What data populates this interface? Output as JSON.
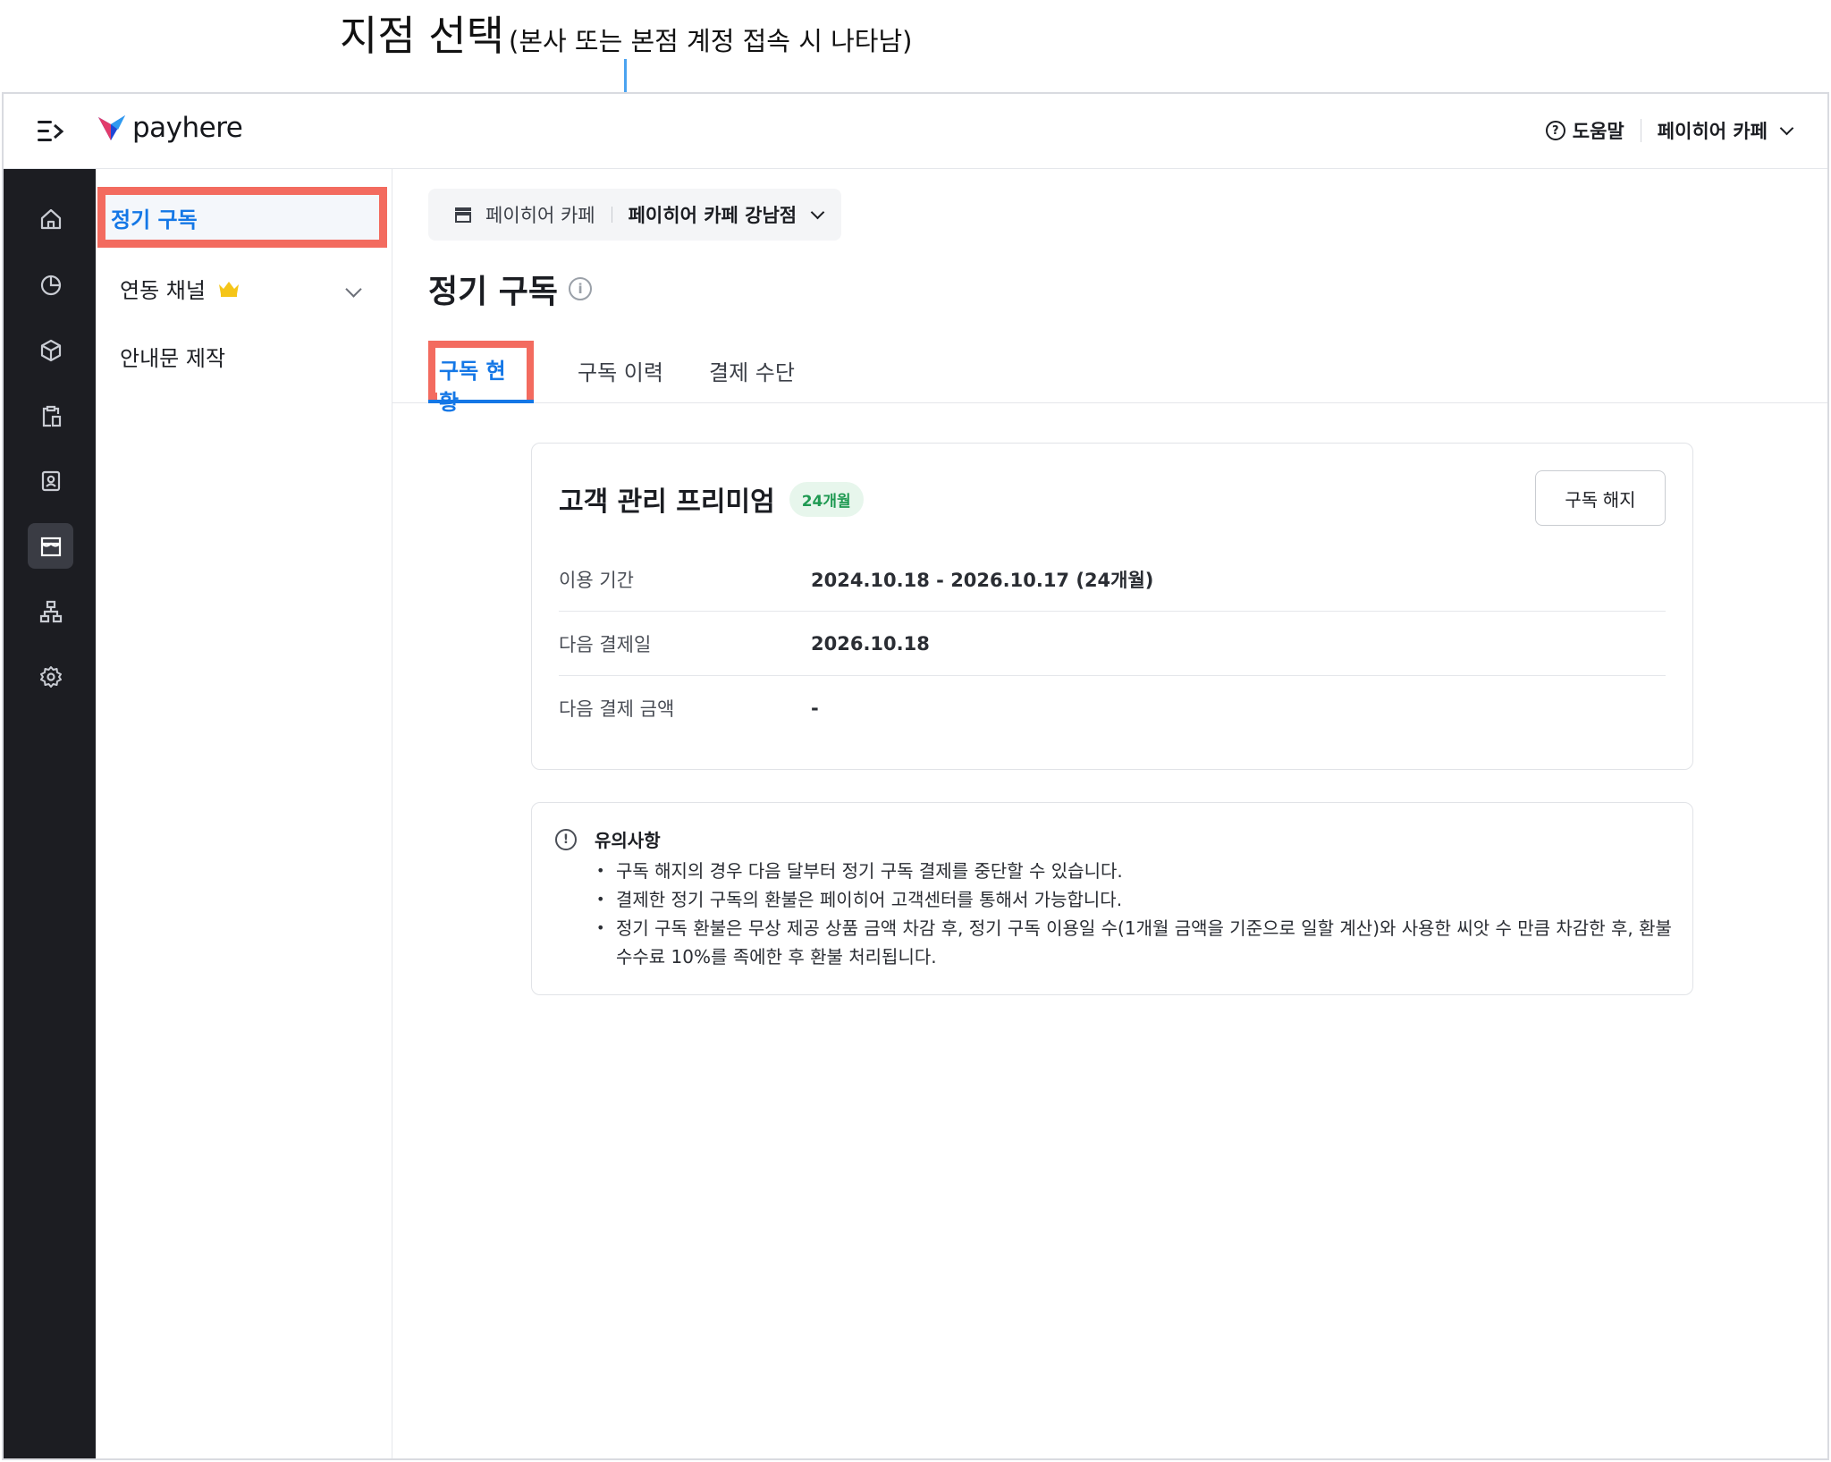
{
  "annotation": {
    "title": "지점 선택",
    "subtitle": "(본사 또는 본점 계정 접속 시 나타남)"
  },
  "header": {
    "logo_text": "payhere",
    "help_label": "도움말",
    "store_name": "페이히어 카페"
  },
  "rail": {
    "icons": [
      "home-icon",
      "pie-chart-icon",
      "box-icon",
      "clipboard-icon",
      "contact-icon",
      "store-icon",
      "org-chart-icon",
      "gear-icon"
    ],
    "active_index": 5
  },
  "submenu": {
    "items": [
      {
        "label": "정기 구독",
        "active": true
      },
      {
        "label": "연동 채널",
        "premium": true,
        "expandable": true
      },
      {
        "label": "안내문 제작"
      }
    ]
  },
  "branch_selector": {
    "organization": "페이히어 카페",
    "selected_branch": "페이히어 카페 강남점"
  },
  "page": {
    "title": "정기 구독"
  },
  "tabs": [
    {
      "label": "구독 현황",
      "active": true
    },
    {
      "label": "구독 이력"
    },
    {
      "label": "결제 수단"
    }
  ],
  "subscription_card": {
    "plan_name": "고객 관리 프리미엄",
    "badge": "24개월",
    "cancel_label": "구독 해지",
    "rows": [
      {
        "label": "이용 기간",
        "value": "2024.10.18 - 2026.10.17 (24개월)"
      },
      {
        "label": "다음 결제일",
        "value": "2026.10.18"
      },
      {
        "label": "다음 결제 금액",
        "value": "-"
      }
    ]
  },
  "notice": {
    "title": "유의사항",
    "items": [
      "구독 해지의 경우 다음 달부터 정기 구독 결제를 중단할 수 있습니다.",
      "결제한 정기 구독의 환불은 페이히어 고객센터를 통해서 가능합니다.",
      "정기 구독 환불은 무상 제공 상품 금액 차감 후, 정기 구독 이용일 수(1개월 금액을 기준으로 일할 계산)와 사용한 씨앗 수 만큼 차감한 후, 환불 수수료 10%를 족에한 후 환불 처리됩니다."
    ]
  },
  "colors": {
    "accent": "#1477e6",
    "highlight": "#f36b5f",
    "rail_bg": "#1c1d22",
    "annotation_line": "#4aa3f0",
    "badge_green": "#1f9a52"
  }
}
